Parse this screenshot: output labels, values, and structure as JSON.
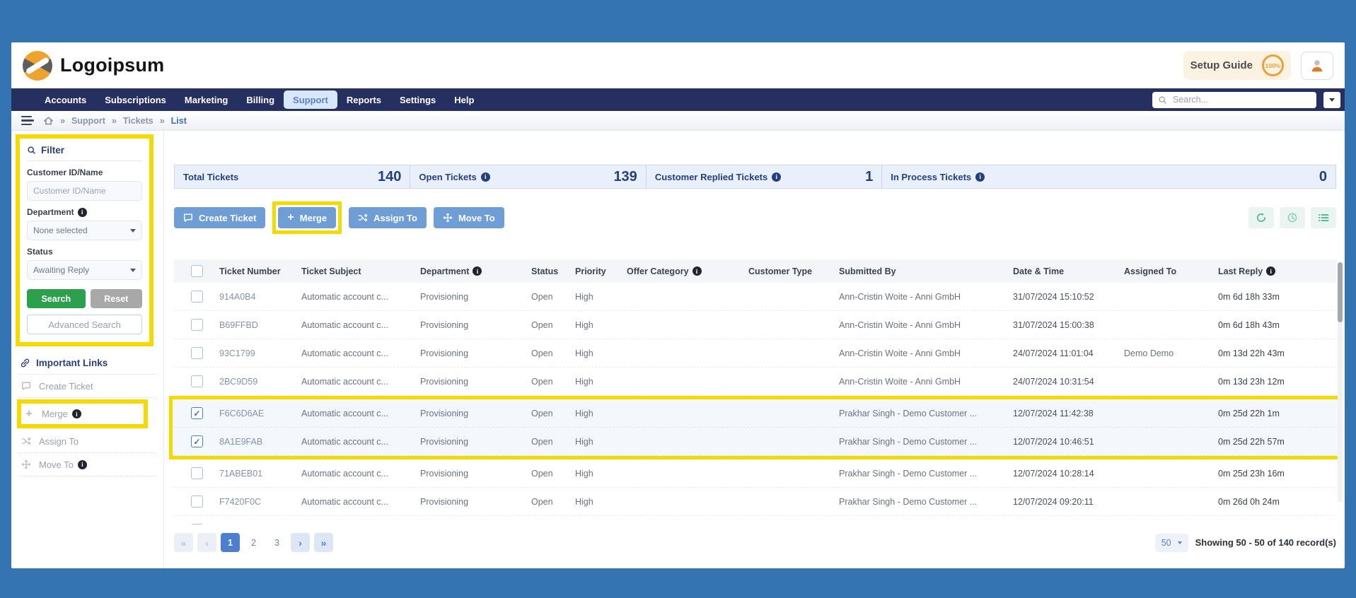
{
  "header": {
    "logo_text": "Logoipsum",
    "setup_guide_label": "Setup Guide",
    "setup_guide_progress": "100%"
  },
  "nav": {
    "items": [
      "Accounts",
      "Subscriptions",
      "Marketing",
      "Billing",
      "Support",
      "Reports",
      "Settings",
      "Help"
    ],
    "active_item": "Support",
    "search_placeholder": "Search..."
  },
  "breadcrumb": {
    "separator": "»",
    "items": [
      "Support",
      "Tickets",
      "List"
    ]
  },
  "sidebar": {
    "filter": {
      "title": "Filter",
      "customer_label": "Customer ID/Name",
      "customer_placeholder": "Customer ID/Name",
      "department_label": "Department",
      "department_value": "None selected",
      "status_label": "Status",
      "status_value": "Awaiting Reply",
      "search_button": "Search",
      "reset_button": "Reset",
      "advanced_search_button": "Advanced Search"
    },
    "links": {
      "title": "Important Links",
      "create_ticket": "Create Ticket",
      "merge": "Merge",
      "assign_to": "Assign To",
      "move_to": "Move To"
    }
  },
  "stats": [
    {
      "label": "Total Tickets",
      "value": "140"
    },
    {
      "label": "Open Tickets",
      "value": "139"
    },
    {
      "label": "Customer Replied Tickets",
      "value": "1"
    },
    {
      "label": "In Process Tickets",
      "value": "0"
    }
  ],
  "toolbar": {
    "create_ticket": "Create Ticket",
    "merge": "Merge",
    "assign_to": "Assign To",
    "move_to": "Move To"
  },
  "table": {
    "columns": [
      "Ticket Number",
      "Ticket Subject",
      "Department",
      "Status",
      "Priority",
      "Offer Category",
      "Customer Type",
      "Submitted By",
      "Date & Time",
      "Assigned To",
      "Last Reply"
    ],
    "rows": [
      {
        "ticket": "914A0B4",
        "subject": "Automatic account c...",
        "department": "Provisioning",
        "status": "Open",
        "priority": "High",
        "offer_category": "",
        "customer_type": "",
        "submitted_by": "Ann-Cristin Woite - Anni GmbH",
        "date": "31/07/2024 15:10:52",
        "assigned": "",
        "last_reply": "0m 6d 18h 33m",
        "checked": false
      },
      {
        "ticket": "B69FFBD",
        "subject": "Automatic account c...",
        "department": "Provisioning",
        "status": "Open",
        "priority": "High",
        "offer_category": "",
        "customer_type": "",
        "submitted_by": "Ann-Cristin Woite - Anni GmbH",
        "date": "31/07/2024 15:00:38",
        "assigned": "",
        "last_reply": "0m 6d 18h 43m",
        "checked": false
      },
      {
        "ticket": "93C1799",
        "subject": "Automatic account c...",
        "department": "Provisioning",
        "status": "Open",
        "priority": "High",
        "offer_category": "",
        "customer_type": "",
        "submitted_by": "Ann-Cristin Woite - Anni GmbH",
        "date": "24/07/2024 11:01:04",
        "assigned": "Demo Demo",
        "last_reply": "0m 13d 22h 43m",
        "checked": false
      },
      {
        "ticket": "2BC9D59",
        "subject": "Automatic account c...",
        "department": "Provisioning",
        "status": "Open",
        "priority": "High",
        "offer_category": "",
        "customer_type": "",
        "submitted_by": "Ann-Cristin Woite - Anni GmbH",
        "date": "24/07/2024 10:31:54",
        "assigned": "",
        "last_reply": "0m 13d 23h 12m",
        "checked": false
      },
      {
        "ticket": "F6C6D6AE",
        "subject": "Automatic account c...",
        "department": "Provisioning",
        "status": "Open",
        "priority": "High",
        "offer_category": "",
        "customer_type": "",
        "submitted_by": "Prakhar Singh - Demo Customer ...",
        "date": "12/07/2024 11:42:38",
        "assigned": "",
        "last_reply": "0m 25d 22h 1m",
        "checked": true
      },
      {
        "ticket": "8A1E9FAB",
        "subject": "Automatic account c...",
        "department": "Provisioning",
        "status": "Open",
        "priority": "High",
        "offer_category": "",
        "customer_type": "",
        "submitted_by": "Prakhar Singh - Demo Customer ...",
        "date": "12/07/2024 10:46:51",
        "assigned": "",
        "last_reply": "0m 25d 22h 57m",
        "checked": true
      },
      {
        "ticket": "71ABEB01",
        "subject": "Automatic account c...",
        "department": "Provisioning",
        "status": "Open",
        "priority": "High",
        "offer_category": "",
        "customer_type": "",
        "submitted_by": "Prakhar Singh - Demo Customer ...",
        "date": "12/07/2024 10:28:14",
        "assigned": "",
        "last_reply": "0m 25d 23h 16m",
        "checked": false
      },
      {
        "ticket": "F7420F0C",
        "subject": "Automatic account c...",
        "department": "Provisioning",
        "status": "Open",
        "priority": "High",
        "offer_category": "",
        "customer_type": "",
        "submitted_by": "Prakhar Singh - Demo Customer ...",
        "date": "12/07/2024 09:20:11",
        "assigned": "",
        "last_reply": "0m 26d 0h 24m",
        "checked": false
      }
    ]
  },
  "pagination": {
    "first": "«",
    "prev": "‹",
    "pages": [
      "1",
      "2",
      "3"
    ],
    "active_page": "1",
    "next": "›",
    "last": "»",
    "page_size": "50",
    "summary": "Showing 50 - 50 of 140 record(s)"
  },
  "colors": {
    "frame_blue": "#3474b3",
    "nav_navy": "#263060",
    "highlight_yellow": "#f4da00",
    "button_blue": "#6f9ed7",
    "search_green": "#2ca04c",
    "stats_navy": "#24407c",
    "tool_teal": "#58b79c",
    "logo_orange": "#eda32e"
  }
}
